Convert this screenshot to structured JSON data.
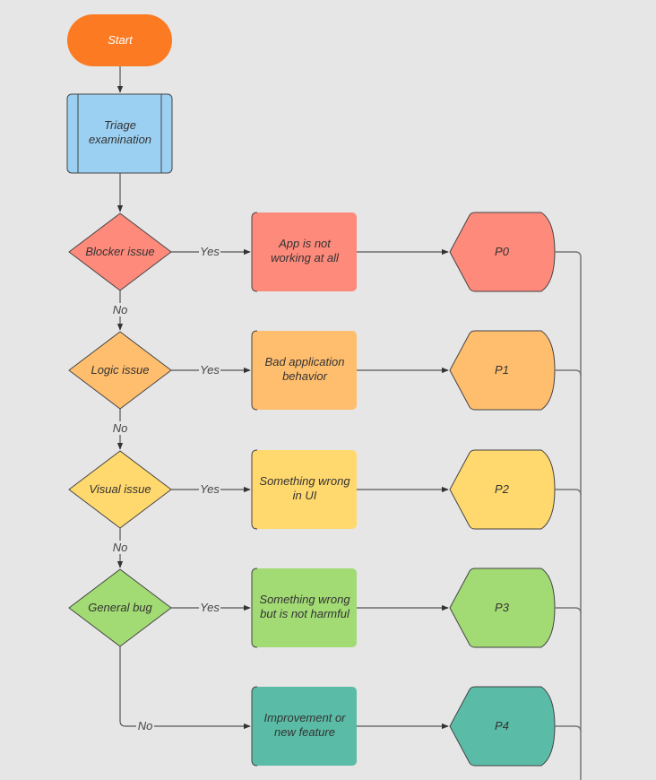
{
  "diagram": {
    "colors": {
      "background": "#e6e6e6",
      "start": "#fc7a22",
      "triage": "#9bd0f2",
      "row0": "#fe8a7b",
      "row1": "#ffbe6e",
      "row2": "#ffd86e",
      "row3": "#a2da74",
      "row4": "#5abba6"
    },
    "start": {
      "label": "Start"
    },
    "triage": {
      "label_lines": [
        "Triage",
        "examination"
      ]
    },
    "rows": [
      {
        "decision": "Blocker issue",
        "edge_yes": "Yes",
        "edge_no": "No",
        "process_lines": [
          "App is not",
          "working at all"
        ],
        "priority": "P0"
      },
      {
        "decision": "Logic issue",
        "edge_yes": "Yes",
        "edge_no": "No",
        "process_lines": [
          "Bad application",
          "behavior"
        ],
        "priority": "P1"
      },
      {
        "decision": "Visual issue",
        "edge_yes": "Yes",
        "edge_no": "No",
        "process_lines": [
          "Something wrong",
          "in UI"
        ],
        "priority": "P2"
      },
      {
        "decision": "General bug",
        "edge_yes": "Yes",
        "edge_no": "No",
        "process_lines": [
          "Something wrong",
          "but is not harmful"
        ],
        "priority": "P3"
      },
      {
        "decision": null,
        "edge_yes": null,
        "edge_no": null,
        "process_lines": [
          "Improvement or",
          "new feature"
        ],
        "priority": "P4"
      }
    ]
  }
}
